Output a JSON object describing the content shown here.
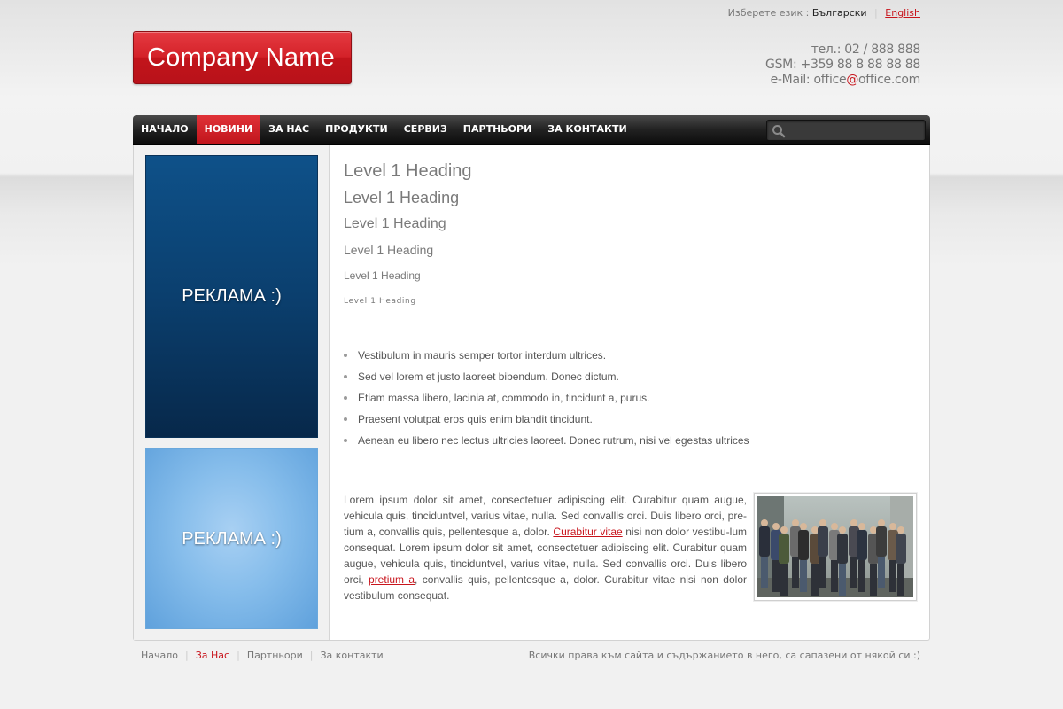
{
  "language": {
    "prompt": "Изберете език :",
    "current": "Български",
    "other": "English"
  },
  "logo": {
    "text": "Company Name"
  },
  "contacts": {
    "phone": "тел.: 02 / 888 888",
    "gsm": "GSM: +359 88 8 88 88 88",
    "email_prefix": "e-Mail: office",
    "email_at": "@",
    "email_suffix": "office.com"
  },
  "nav": {
    "items": [
      {
        "label": "НАЧАЛО"
      },
      {
        "label": "НОВИНИ",
        "active": true
      },
      {
        "label": "ЗА НАС"
      },
      {
        "label": "ПРОДУКТИ"
      },
      {
        "label": "СЕРВИЗ"
      },
      {
        "label": "ПАРТНЬОРИ"
      },
      {
        "label": "ЗА КОНТАКТИ"
      }
    ],
    "search_placeholder": ""
  },
  "sidebar": {
    "ads": [
      {
        "label": "РЕКЛАМА :)"
      },
      {
        "label": "РЕКЛАМА :)"
      }
    ]
  },
  "content": {
    "headings": [
      "Level 1 Heading",
      "Level 1 Heading",
      "Level 1 Heading",
      "Level 1 Heading",
      "Level 1 Heading",
      "Level 1 Heading"
    ],
    "list": [
      "Vestibulum in mauris semper tortor interdum ultrices.",
      "Sed vel lorem et justo laoreet bibendum. Donec dictum.",
      "Etiam massa libero, lacinia at, commodo in, tincidunt a, purus.",
      "Praesent volutpat eros quis enim blandit tincidunt.",
      "Aenean eu libero nec lectus ultricies laoreet. Donec rutrum, nisi vel egestas ultrices"
    ],
    "paragraph": {
      "part1": "Lorem ipsum dolor sit amet, consectetuer adipiscing elit. Curabitur quam augue, vehicula quis, tinciduntvel, varius vitae, nulla. Sed convallis orci. Duis libero orci, pre-tium a, convallis quis, pellentesque a, dolor. ",
      "link1": "Curabitur vitae",
      "part2": " nisi non dolor vestibu-lum consequat. Lorem ipsum dolor sit amet, consectetuer adipiscing elit. Curabitur quam augue, vehicula quis, tinciduntvel, varius vitae, nulla. Sed convallis orci. Duis libero orci, ",
      "link2": "pretium a",
      "part3": ", convallis quis, pellentesque a, dolor. Curabitur vitae nisi non dolor vestibulum consequat."
    }
  },
  "footer": {
    "links": [
      {
        "label": "Начало"
      },
      {
        "label": "За Нас",
        "active": true
      },
      {
        "label": "Партньори"
      },
      {
        "label": "За контакти"
      }
    ],
    "copyright": "Всички права към сайта и съдържанието в него, са сапазени от някой си :)"
  },
  "colors": {
    "accent": "#c8141c",
    "nav_bg": "#1a1a1a",
    "ad_dark": "#0b3f6e",
    "ad_light": "#86bdeb"
  }
}
